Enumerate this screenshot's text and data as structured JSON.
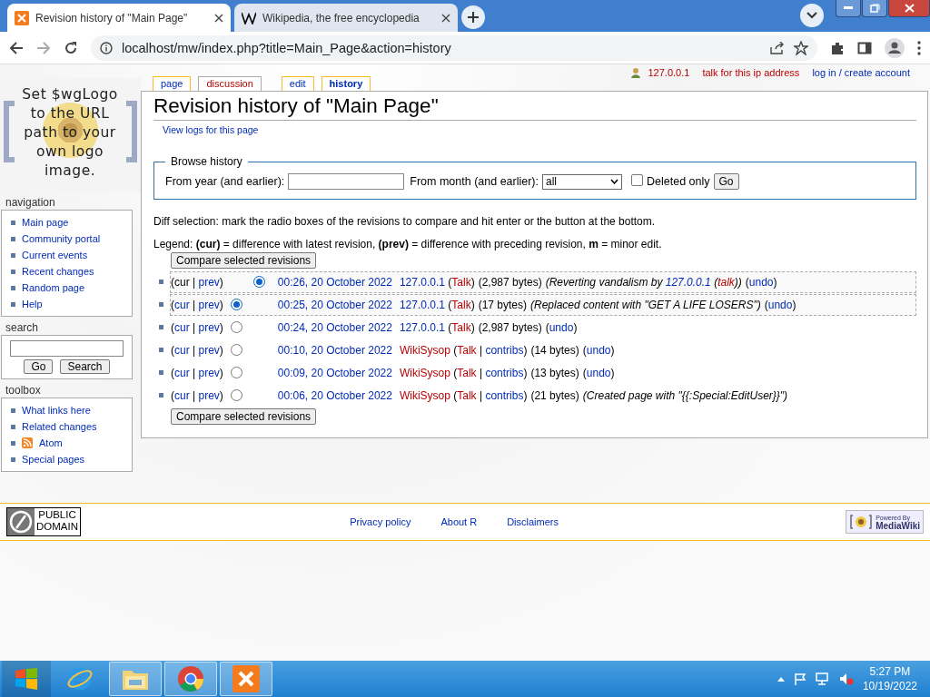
{
  "browser": {
    "tabs": [
      {
        "title": "Revision history of \"Main Page\"",
        "selected": true,
        "kind": "xampp"
      },
      {
        "title": "Wikipedia, the free encyclopedia",
        "selected": false,
        "kind": "wiki"
      }
    ],
    "address": "localhost/mw/index.php?title=Main_Page&action=history"
  },
  "personal": {
    "ip": "127.0.0.1",
    "talk": "talk for this ip address",
    "login": "log in / create account"
  },
  "page_tabs": [
    {
      "label": "page",
      "selected": false,
      "kind": "link"
    },
    {
      "label": "discussion",
      "selected": false,
      "kind": "new"
    },
    {
      "label": "edit",
      "selected": false,
      "kind": "link"
    },
    {
      "label": "history",
      "selected": true,
      "kind": "link"
    }
  ],
  "logo_text": "Set $wgLogo to the URL path to your own logo image.",
  "sidebar": {
    "navigation": {
      "title": "navigation",
      "items": [
        {
          "label": "Main page"
        },
        {
          "label": "Community portal"
        },
        {
          "label": "Current events"
        },
        {
          "label": "Recent changes"
        },
        {
          "label": "Random page"
        },
        {
          "label": "Help"
        }
      ]
    },
    "search": {
      "title": "search",
      "buttons": [
        "Go",
        "Search"
      ]
    },
    "toolbox": {
      "title": "toolbox",
      "items": [
        {
          "label": "What links here",
          "kind": "link"
        },
        {
          "label": "Related changes",
          "kind": "link"
        },
        {
          "label": "Atom",
          "kind": "feed"
        },
        {
          "label": "Special pages",
          "kind": "link"
        }
      ]
    }
  },
  "title": "Revision history of \"Main Page\"",
  "subtitle": "View logs for this page",
  "browse": {
    "legend": "Browse history",
    "year_label": "From year (and earlier):",
    "month_label": "From month (and earlier):",
    "month_value": "all",
    "deleted_label": "Deleted only",
    "deleted_checked": false,
    "go": "Go"
  },
  "diff_help": "Diff selection: mark the radio boxes of the revisions to compare and hit enter or the button at the bottom.",
  "legend": "Legend: **(cur)** = difference with latest revision, **(prev)** = difference with preceding revision, **m** = minor edit.",
  "compare_buttons": [
    "Compare selected revisions",
    "Compare selected revisions"
  ],
  "revisions": [
    {
      "kind": "newest",
      "selected": true,
      "diff": [
        {
          "text": "(",
          "kind": "plain"
        },
        {
          "text": "cur",
          "kind": "plain"
        },
        {
          "text": " | ",
          "kind": "plain"
        },
        {
          "text": "prev",
          "kind": "link"
        },
        {
          "text": ")",
          "kind": "plain"
        }
      ],
      "time": "00:26, 20 October 2022",
      "user": [
        {
          "text": "127.0.0.1",
          "kind": "link"
        },
        {
          "text": " (",
          "kind": "plain"
        },
        {
          "text": "Talk",
          "kind": "new"
        },
        {
          "text": ")",
          "kind": "plain"
        }
      ],
      "size": "(2,987 bytes)",
      "comment": [
        {
          "text": "(Reverting vandalism by ",
          "kind": "plain"
        },
        {
          "text": "127.0.0.1",
          "kind": "link"
        },
        {
          "text": " (",
          "kind": "plain"
        },
        {
          "text": "talk",
          "kind": "new"
        },
        {
          "text": "))",
          "kind": "plain"
        }
      ],
      "undo": [
        {
          "text": "(",
          "kind": "plain"
        },
        {
          "text": "undo",
          "kind": "link"
        },
        {
          "text": ")",
          "kind": "plain"
        }
      ]
    },
    {
      "kind": "older",
      "selected": true,
      "diff": [
        {
          "text": "(",
          "kind": "plain"
        },
        {
          "text": "cur",
          "kind": "link"
        },
        {
          "text": " | ",
          "kind": "plain"
        },
        {
          "text": "prev",
          "kind": "link"
        },
        {
          "text": ")",
          "kind": "plain"
        }
      ],
      "time": "00:25, 20 October 2022",
      "user": [
        {
          "text": "127.0.0.1",
          "kind": "link"
        },
        {
          "text": " (",
          "kind": "plain"
        },
        {
          "text": "Talk",
          "kind": "new"
        },
        {
          "text": ")",
          "kind": "plain"
        }
      ],
      "size": "(17 bytes)",
      "comment": [
        {
          "text": "(Replaced content with \"GET A LIFE LOSERS\")",
          "kind": "plain"
        }
      ],
      "undo": [
        {
          "text": "(",
          "kind": "plain"
        },
        {
          "text": "undo",
          "kind": "link"
        },
        {
          "text": ")",
          "kind": "plain"
        }
      ]
    },
    {
      "kind": "older",
      "selected": false,
      "diff": [
        {
          "text": "(",
          "kind": "plain"
        },
        {
          "text": "cur",
          "kind": "link"
        },
        {
          "text": " | ",
          "kind": "plain"
        },
        {
          "text": "prev",
          "kind": "link"
        },
        {
          "text": ")",
          "kind": "plain"
        }
      ],
      "time": "00:24, 20 October 2022",
      "user": [
        {
          "text": "127.0.0.1",
          "kind": "link"
        },
        {
          "text": " (",
          "kind": "plain"
        },
        {
          "text": "Talk",
          "kind": "new"
        },
        {
          "text": ")",
          "kind": "plain"
        }
      ],
      "size": "(2,987 bytes)",
      "undo": [
        {
          "text": "(",
          "kind": "plain"
        },
        {
          "text": "undo",
          "kind": "link"
        },
        {
          "text": ")",
          "kind": "plain"
        }
      ]
    },
    {
      "kind": "older",
      "selected": false,
      "diff": [
        {
          "text": "(",
          "kind": "plain"
        },
        {
          "text": "cur",
          "kind": "link"
        },
        {
          "text": " | ",
          "kind": "plain"
        },
        {
          "text": "prev",
          "kind": "link"
        },
        {
          "text": ")",
          "kind": "plain"
        }
      ],
      "time": "00:10, 20 October 2022",
      "user": [
        {
          "text": "WikiSysop",
          "kind": "new"
        },
        {
          "text": " (",
          "kind": "plain"
        },
        {
          "text": "Talk",
          "kind": "new"
        },
        {
          "text": " | ",
          "kind": "plain"
        },
        {
          "text": "contribs",
          "kind": "link"
        },
        {
          "text": ")",
          "kind": "plain"
        }
      ],
      "size": "(14 bytes)",
      "undo": [
        {
          "text": "(",
          "kind": "plain"
        },
        {
          "text": "undo",
          "kind": "link"
        },
        {
          "text": ")",
          "kind": "plain"
        }
      ]
    },
    {
      "kind": "older",
      "selected": false,
      "diff": [
        {
          "text": "(",
          "kind": "plain"
        },
        {
          "text": "cur",
          "kind": "link"
        },
        {
          "text": " | ",
          "kind": "plain"
        },
        {
          "text": "prev",
          "kind": "link"
        },
        {
          "text": ")",
          "kind": "plain"
        }
      ],
      "time": "00:09, 20 October 2022",
      "user": [
        {
          "text": "WikiSysop",
          "kind": "new"
        },
        {
          "text": " (",
          "kind": "plain"
        },
        {
          "text": "Talk",
          "kind": "new"
        },
        {
          "text": " | ",
          "kind": "plain"
        },
        {
          "text": "contribs",
          "kind": "link"
        },
        {
          "text": ")",
          "kind": "plain"
        }
      ],
      "size": "(13 bytes)",
      "undo": [
        {
          "text": "(",
          "kind": "plain"
        },
        {
          "text": "undo",
          "kind": "link"
        },
        {
          "text": ")",
          "kind": "plain"
        }
      ]
    },
    {
      "kind": "older",
      "selected": false,
      "diff": [
        {
          "text": "(",
          "kind": "plain"
        },
        {
          "text": "cur",
          "kind": "link"
        },
        {
          "text": " | ",
          "kind": "plain"
        },
        {
          "text": "prev",
          "kind": "link"
        },
        {
          "text": ")",
          "kind": "plain"
        }
      ],
      "time": "00:06, 20 October 2022",
      "user": [
        {
          "text": "WikiSysop",
          "kind": "new"
        },
        {
          "text": " (",
          "kind": "plain"
        },
        {
          "text": "Talk",
          "kind": "new"
        },
        {
          "text": " | ",
          "kind": "plain"
        },
        {
          "text": "contribs",
          "kind": "link"
        },
        {
          "text": ")",
          "kind": "plain"
        }
      ],
      "size": "(21 bytes)",
      "comment": [
        {
          "text": "(Created page with \"{{:Special:EditUser}}\")",
          "kind": "plain"
        }
      ]
    }
  ],
  "footer": {
    "copyright": [
      "PUBLIC",
      "DOMAIN"
    ],
    "links": [
      "Privacy policy",
      "About R",
      "Disclaimers"
    ],
    "powered": [
      "Powered By",
      "MediaWiki"
    ]
  },
  "taskbar": {
    "apps": [
      {
        "kind": "ie",
        "selected": false
      },
      {
        "kind": "folder",
        "selected": true
      },
      {
        "kind": "chrome",
        "selected": true
      },
      {
        "kind": "xampp",
        "selected": true
      }
    ],
    "time": "5:27 PM",
    "date": "10/19/2022"
  }
}
